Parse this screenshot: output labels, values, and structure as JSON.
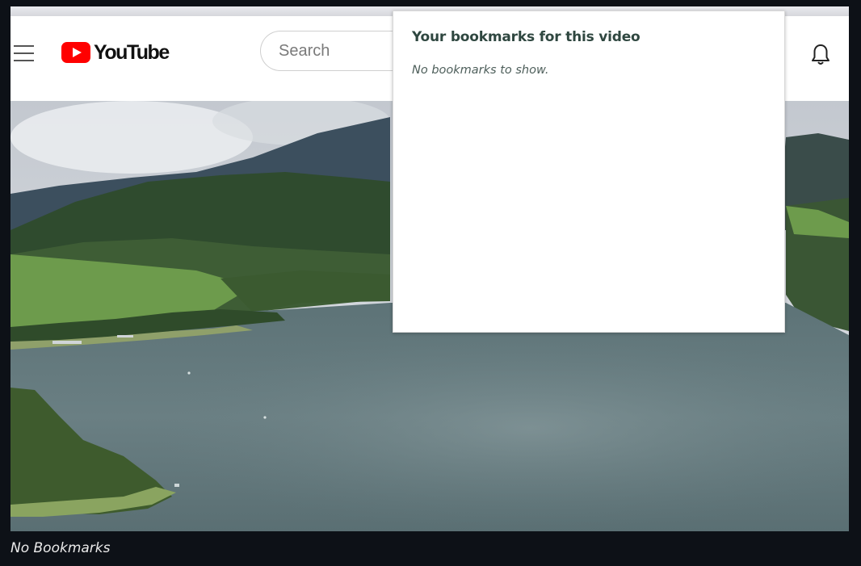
{
  "youtube_header": {
    "logo_text": "YouTube",
    "search_placeholder": "Search",
    "icons": [
      "menu-icon",
      "youtube-play-icon",
      "bell-icon"
    ]
  },
  "bookmarks_popup": {
    "title": "Your bookmarks for this video",
    "empty_message": "No bookmarks to show."
  },
  "figure": {
    "caption": "No Bookmarks"
  },
  "colors": {
    "brand_red": "#ff0000",
    "popup_title": "#2f4740",
    "page_background": "#0d1117"
  }
}
